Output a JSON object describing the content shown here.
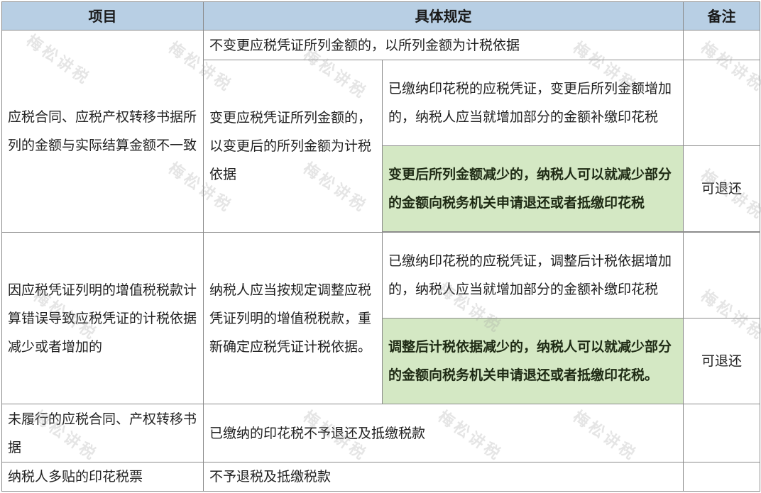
{
  "header": {
    "col_item": "项目",
    "col_rule": "具体规定",
    "col_note": "备注"
  },
  "rows": {
    "r1": {
      "item": "应税合同、应税产权转移书据所列的金额与实际结算金额不一致",
      "no_change": "不变更应税凭证所列金额的，以所列金额为计税依据",
      "change": "变更应税凭证所列金额的，以变更后的所列金额为计税依据",
      "increase": "已缴纳印花税的应税凭证，变更后所列金额增加的，纳税人应当就增加部分的金额补缴印花税",
      "decrease": "变更后所列金额减少的，纳税人可以就减少部分的金额向税务机关申请退还或者抵缴印花税",
      "decrease_note": "可退还"
    },
    "r2": {
      "item": "因应税凭证列明的增值税税款计算错误导致应税凭证的计税依据减少或者增加的",
      "rule": "纳税人应当按规定调整应税凭证列明的增值税税款，重新确定应税凭证计税依据。",
      "increase": "已缴纳印花税的应税凭证，调整后计税依据增加的，纳税人应当就增加部分的金额补缴印花税",
      "decrease": "调整后计税依据减少的，纳税人可以就减少部分的金额向税务机关申请退还或者抵缴印花税。",
      "decrease_note": "可退还"
    },
    "r3": {
      "item": "未履行的应税合同、产权转移书据",
      "rule": "已缴纳的印花税不予退还及抵缴税款"
    },
    "r4": {
      "item": "纳税人多贴的印花税票",
      "rule": "不予退税及抵缴税款"
    }
  },
  "watermark": {
    "text": "梅松讲税"
  }
}
